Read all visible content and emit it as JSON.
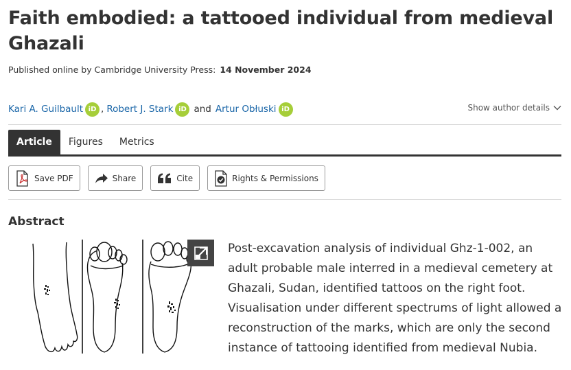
{
  "article": {
    "title": "Faith embodied: a tattooed individual from medieval Ghazali",
    "published_label": "Published online by Cambridge University Press:",
    "published_date": "14 November 2024"
  },
  "authors": {
    "list": [
      {
        "name": "Kari A. Guilbault",
        "orcid": "iD"
      },
      {
        "name": "Robert J. Stark",
        "orcid": "iD"
      },
      {
        "name": "Artur Obłuski",
        "orcid": "iD"
      }
    ],
    "separator": ",",
    "conjunction": "and",
    "show_details_label": "Show author details"
  },
  "tabs": [
    {
      "label": "Article",
      "active": true
    },
    {
      "label": "Figures",
      "active": false
    },
    {
      "label": "Metrics",
      "active": false
    }
  ],
  "actions": {
    "save_pdf": {
      "label": "Save PDF",
      "icon": "pdf-icon"
    },
    "share": {
      "label": "Share",
      "icon": "share-icon"
    },
    "cite": {
      "label": "Cite",
      "icon": "quote-icon"
    },
    "rights": {
      "label": "Rights & Permissions",
      "icon": "rights-icon"
    }
  },
  "abstract": {
    "heading": "Abstract",
    "text": "Post-excavation analysis of individual Ghz-1-002, an adult probable male interred in a medieval cemetery at Ghazali, Sudan, identified tattoos on the right foot. Visualisation under different spectrums of light allowed a reconstruction of the marks, which are only the second instance of tattooing identified from medieval Nubia."
  },
  "colors": {
    "text": "#333333",
    "link": "#1a66a8",
    "orcid": "#a6ce39",
    "active_tab_bg": "#333333",
    "border": "#d8d8d8"
  }
}
